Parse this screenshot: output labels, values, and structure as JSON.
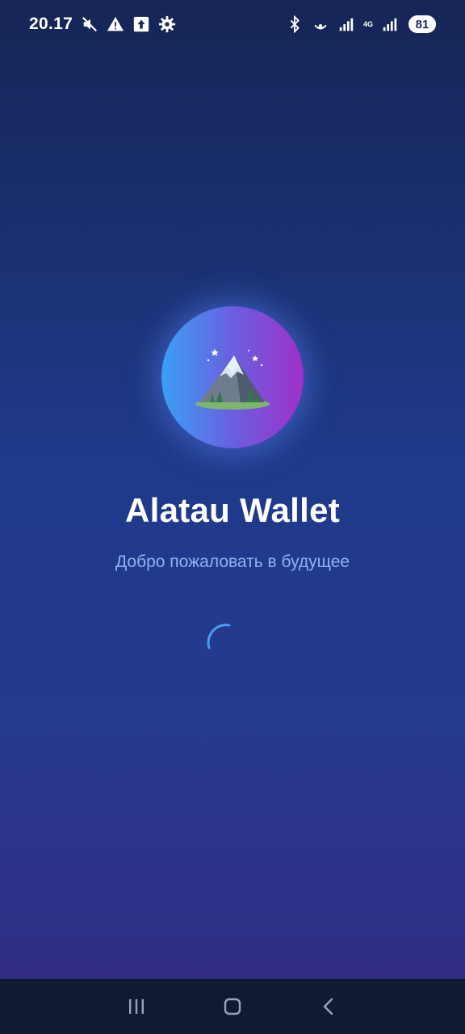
{
  "status_bar": {
    "time": "20.17",
    "network_label": "4G",
    "battery": "81",
    "icons": [
      "mute-icon",
      "warning-icon",
      "upload-icon",
      "settings-icon",
      "bluetooth-icon",
      "hotspot-icon",
      "signal-icon",
      "signal-icon"
    ]
  },
  "app": {
    "title": "Alatau Wallet",
    "subtitle": "Добро пожаловать в будущее",
    "logo_icon": "mountain-icon",
    "accent_colors": [
      "#3aa0f5",
      "#a030c8"
    ]
  },
  "loader": {
    "icon": "spinner-icon",
    "color": "#4a9cf0"
  },
  "nav_bar": {
    "buttons": [
      "recent-apps-icon",
      "home-icon",
      "back-icon"
    ]
  }
}
